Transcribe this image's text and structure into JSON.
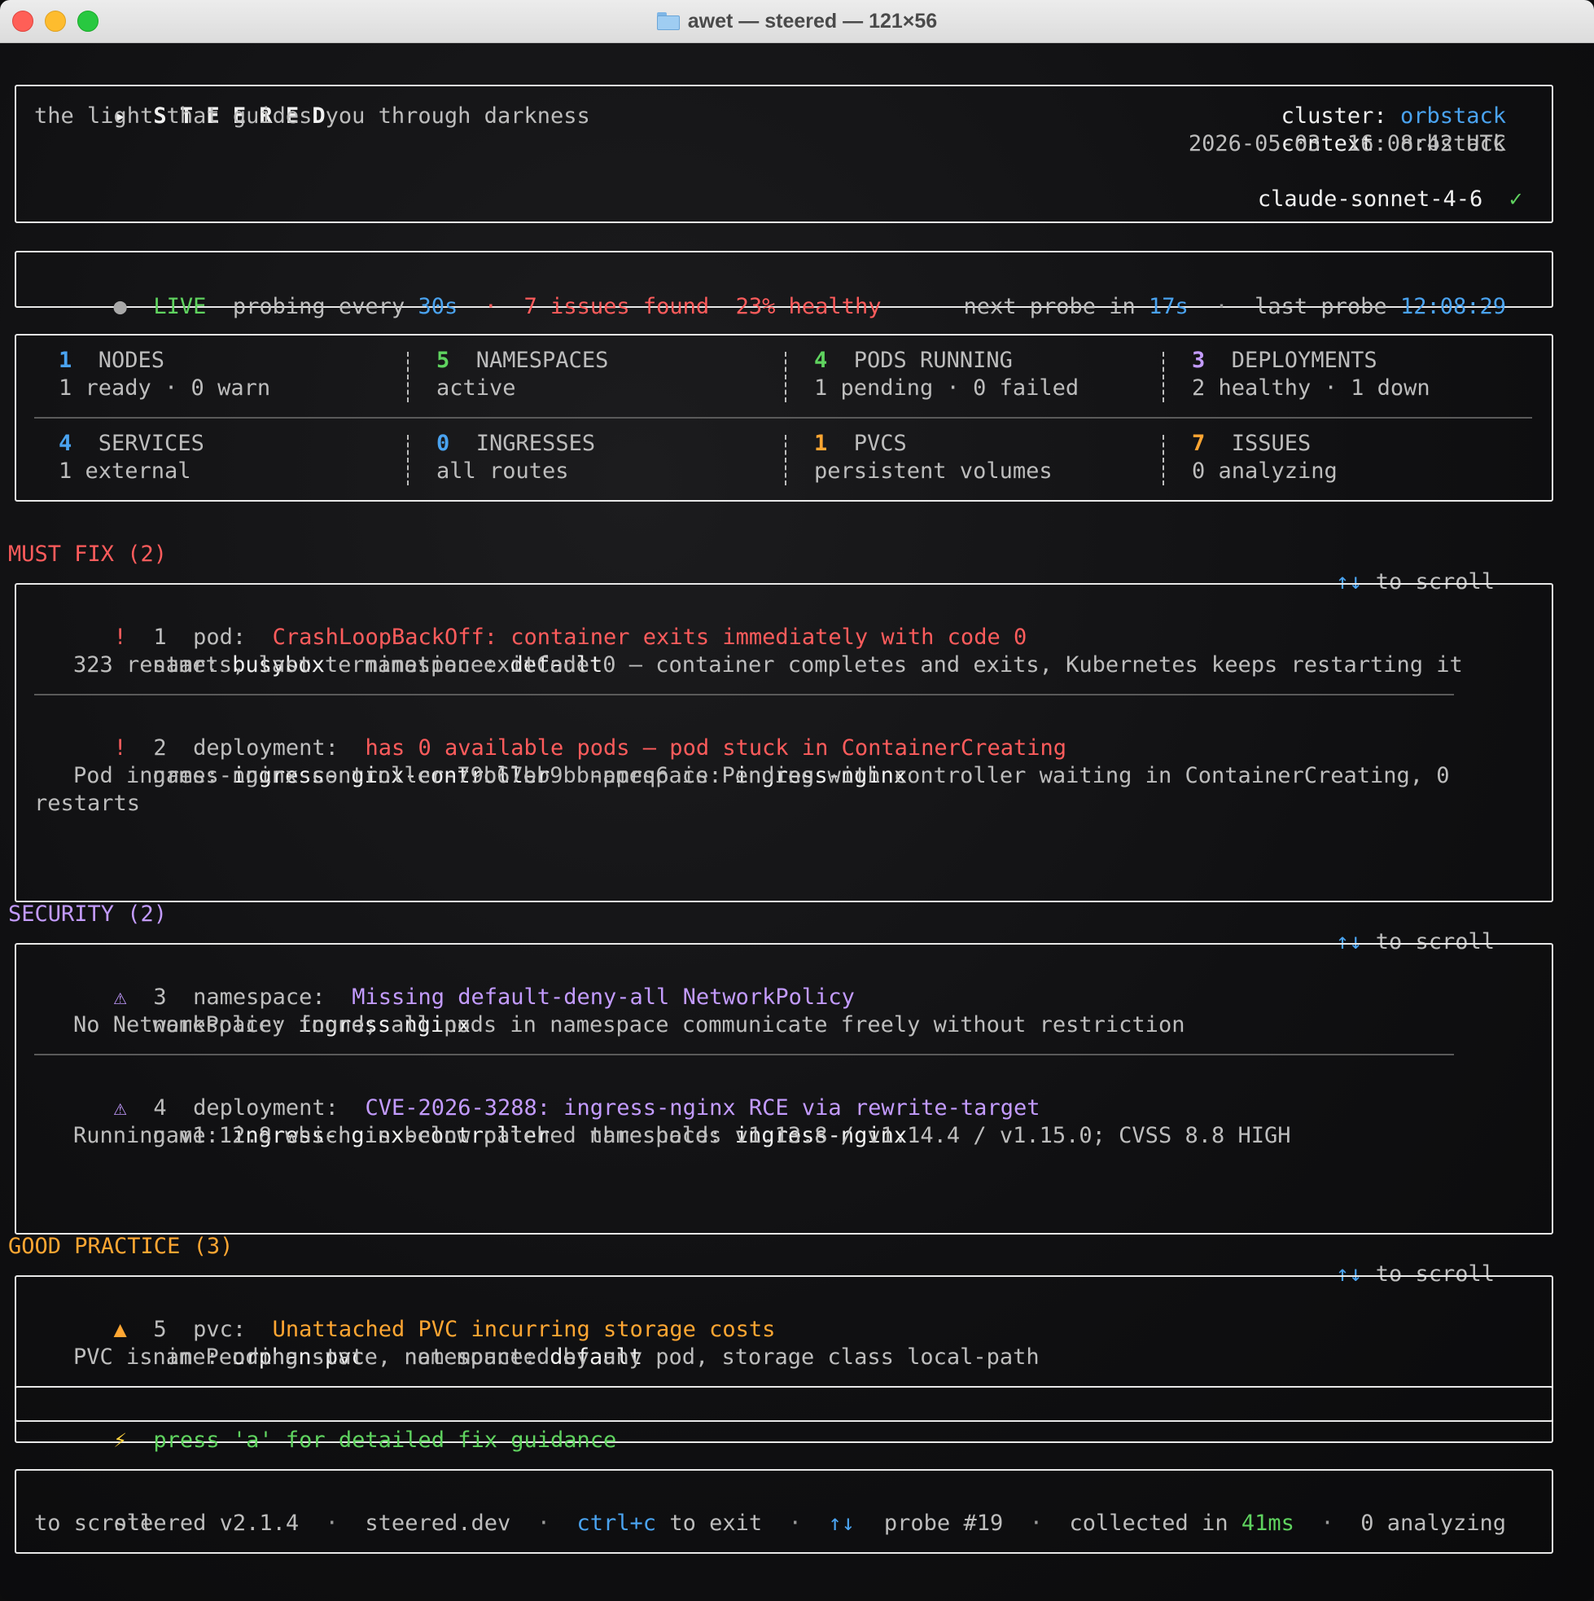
{
  "window": {
    "title": "awet — steered — 121×56"
  },
  "header": {
    "logo_arrow": "▸",
    "app_name": "S T E E R E D",
    "tagline": "the light that guides you through darkness",
    "cluster_label": "cluster:",
    "cluster_value": "orbstack",
    "context_label": "context:",
    "context_value": "orbstack",
    "datetime": "2026-05-03  16:08:42 UTC",
    "model": "claude-sonnet-4-6",
    "model_check": "✓"
  },
  "status": {
    "dot": "●",
    "live": "LIVE",
    "probing_label": "probing every",
    "probing_value": "30s",
    "sep": "·",
    "issues": "7 issues found",
    "healthy": "23% healthy",
    "next_label": "next probe in",
    "next_value": "17s",
    "last_label": "last probe",
    "last_value": "12:08:29",
    "health_percent": 23
  },
  "stats": [
    {
      "num": "1",
      "label": "NODES",
      "sub": "1 ready · 0 warn",
      "color": "#4aa3f0"
    },
    {
      "num": "5",
      "label": "NAMESPACES",
      "sub": "active",
      "color": "#5fd35f"
    },
    {
      "num": "4",
      "label": "PODS RUNNING",
      "sub": "1 pending · 0 failed",
      "color": "#5fd35f"
    },
    {
      "num": "3",
      "label": "DEPLOYMENTS",
      "sub": "2 healthy · 1 down",
      "color": "#c39bff"
    },
    {
      "num": "4",
      "label": "SERVICES",
      "sub": "1 external",
      "color": "#4aa3f0"
    },
    {
      "num": "0",
      "label": "INGRESSES",
      "sub": "all routes",
      "color": "#4aa3f0"
    },
    {
      "num": "1",
      "label": "PVCS",
      "sub": "persistent volumes",
      "color": "#ffa632"
    },
    {
      "num": "7",
      "label": "ISSUES",
      "sub": "0 analyzing",
      "color": "#ffa632"
    }
  ],
  "scroll_hint": {
    "arrows": "↑↓",
    "text": "to scroll"
  },
  "must_fix": {
    "heading": "MUST FIX (2)",
    "issues": [
      {
        "marker": "!",
        "index": "1",
        "kind": "pod:",
        "summary": "CrashLoopBackOff: container exits immediately with code 0",
        "name_label": "name:",
        "name": "busybox",
        "ns_label": "namespace:",
        "ns": "default",
        "detail": "323 restarts, last termination exitCode 0 — container completes and exits, Kubernetes keeps restarting it"
      },
      {
        "marker": "!",
        "index": "2",
        "kind": "deployment:",
        "summary": "has 0 available pods — pod stuck in ContainerCreating",
        "name_label": "name:",
        "name": "ingress-nginx-controller",
        "ns_label": "namespace:",
        "ns": "ingress-nginx",
        "detail": "Pod ingress-nginx-controller-79b67bb9bb-pprq6 is Pending with controller waiting in ContainerCreating, 0",
        "detail_cont": "restarts"
      }
    ]
  },
  "security": {
    "heading": "SECURITY (2)",
    "issues": [
      {
        "marker": "⚠",
        "index": "3",
        "kind": "namespace:",
        "summary": "Missing default-deny-all NetworkPolicy",
        "ns_label": "namespace:",
        "ns": "ingress-nginx",
        "detail": "No NetworkPolicy found; all pods in namespace communicate freely without restriction"
      },
      {
        "marker": "⚠",
        "index": "4",
        "kind": "deployment:",
        "summary": "CVE-2026-3288: ingress-nginx RCE via rewrite-target",
        "name_label": "name:",
        "name": "ingress-nginx-controller",
        "ns_label": "namespace:",
        "ns": "ingress-nginx",
        "detail": "Running v1.12.8 which is below patched thresholds v1.13.8 / v1.14.4 / v1.15.0; CVSS 8.8 HIGH"
      }
    ]
  },
  "good_practice": {
    "heading": "GOOD PRACTICE (3)",
    "issues": [
      {
        "marker": "▲",
        "index": "5",
        "kind": "pvc:",
        "summary": "Unattached PVC incurring storage costs",
        "name_label": "name:",
        "name": "orphan-pvc",
        "ns_label": "namespace:",
        "ns": "default",
        "detail": "PVC is in Pending state, not mounted by any pod, storage class local-path"
      }
    ]
  },
  "hint": {
    "icon": "⚡",
    "text": "press 'a' for detailed fix guidance"
  },
  "footer": {
    "version": "steered v2.1.4",
    "sep": "·",
    "site": "steered.dev",
    "keys": "ctrl+c",
    "exit": "to exit",
    "arrows": "↑↓",
    "scroll_cont": "to scroll",
    "probe": "probe #19",
    "collected_label": "collected in",
    "collected_value": "41ms",
    "analyzing": "0 analyzing"
  }
}
